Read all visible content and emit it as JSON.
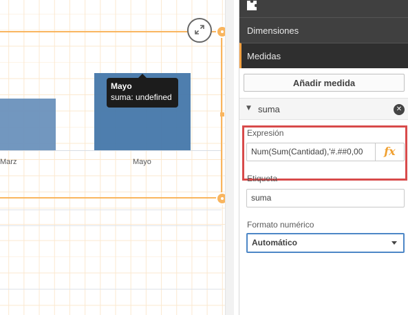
{
  "chart": {
    "categories": [
      {
        "label": "Marz"
      },
      {
        "label": "Mayo"
      }
    ],
    "tooltip": {
      "title": "Mayo",
      "line": "suma: undefined"
    }
  },
  "panel": {
    "nav": {
      "dimensions_label": "Dimensiones",
      "measures_label": "Medidas"
    },
    "add_measure_label": "Añadir medida",
    "measure": {
      "name": "suma",
      "expression_label": "Expresión",
      "expression_value": "Num(Sum(Cantidad),'#.##0,00",
      "fx_label": "fx",
      "label_label": "Etiqueta",
      "label_value": "suma",
      "number_format_label": "Formato numérico",
      "number_format_value": "Automático"
    }
  },
  "colors": {
    "accent": "#f9b55e",
    "bar": "#4477aa",
    "highlight": "#d84a4a",
    "select_border": "#4c86c6"
  },
  "icons": [
    "expand-icon",
    "puzzle-icon",
    "caret-down-icon",
    "remove-icon",
    "fx-icon",
    "chevron-down-icon"
  ]
}
